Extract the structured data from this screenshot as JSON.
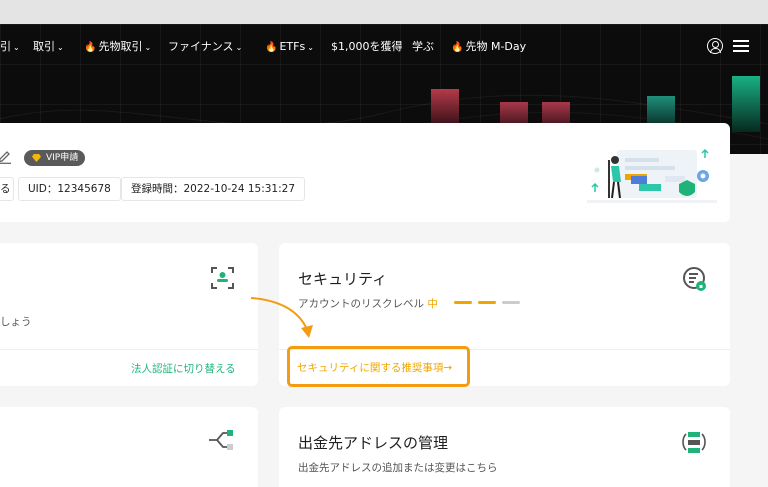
{
  "nav": {
    "items": [
      {
        "label": "引",
        "caret": "⌄",
        "fire": false
      },
      {
        "label": "取引",
        "caret": "⌄",
        "fire": false
      },
      {
        "label": "先物取引",
        "caret": "⌄",
        "fire": true
      },
      {
        "label": "ファイナンス",
        "caret": "⌄",
        "fire": false
      },
      {
        "label": "ETFs",
        "caret": "⌄",
        "fire": true
      },
      {
        "label": "$1,000を獲得",
        "caret": "",
        "fire": false
      },
      {
        "label": "学ぶ",
        "caret": "",
        "fire": false
      },
      {
        "label": "先物 M-Day",
        "caret": "",
        "fire": true
      }
    ],
    "fire_icon": "fire-icon",
    "right_icons": [
      "user-icon",
      "menu-icon"
    ]
  },
  "profile": {
    "vip_label": "VIP申請",
    "chip_partial": "る",
    "uid_label": "UID：12345678",
    "registered_label": "登録時間：2022-10-24 15:31:27"
  },
  "verification": {
    "desc_partial": "しょう",
    "switch_link": "法人認証に切り替える"
  },
  "security": {
    "title": "セキュリティ",
    "risk_prefix": "アカウントのリスクレベル",
    "risk_level": "中",
    "risk_bars": [
      {
        "color": "#f0a500"
      },
      {
        "color": "#f0a500"
      },
      {
        "color": "#cccccc"
      }
    ],
    "recommend_link": "セキュリティに関する推奨事項→"
  },
  "withdraw": {
    "title": "出金先アドレスの管理",
    "desc": "出金先アドレスの追加または変更はこちら"
  },
  "colors": {
    "accent_orange": "#f39c12",
    "green": "#1fb37a",
    "header_bg": "#0c0c0c"
  }
}
